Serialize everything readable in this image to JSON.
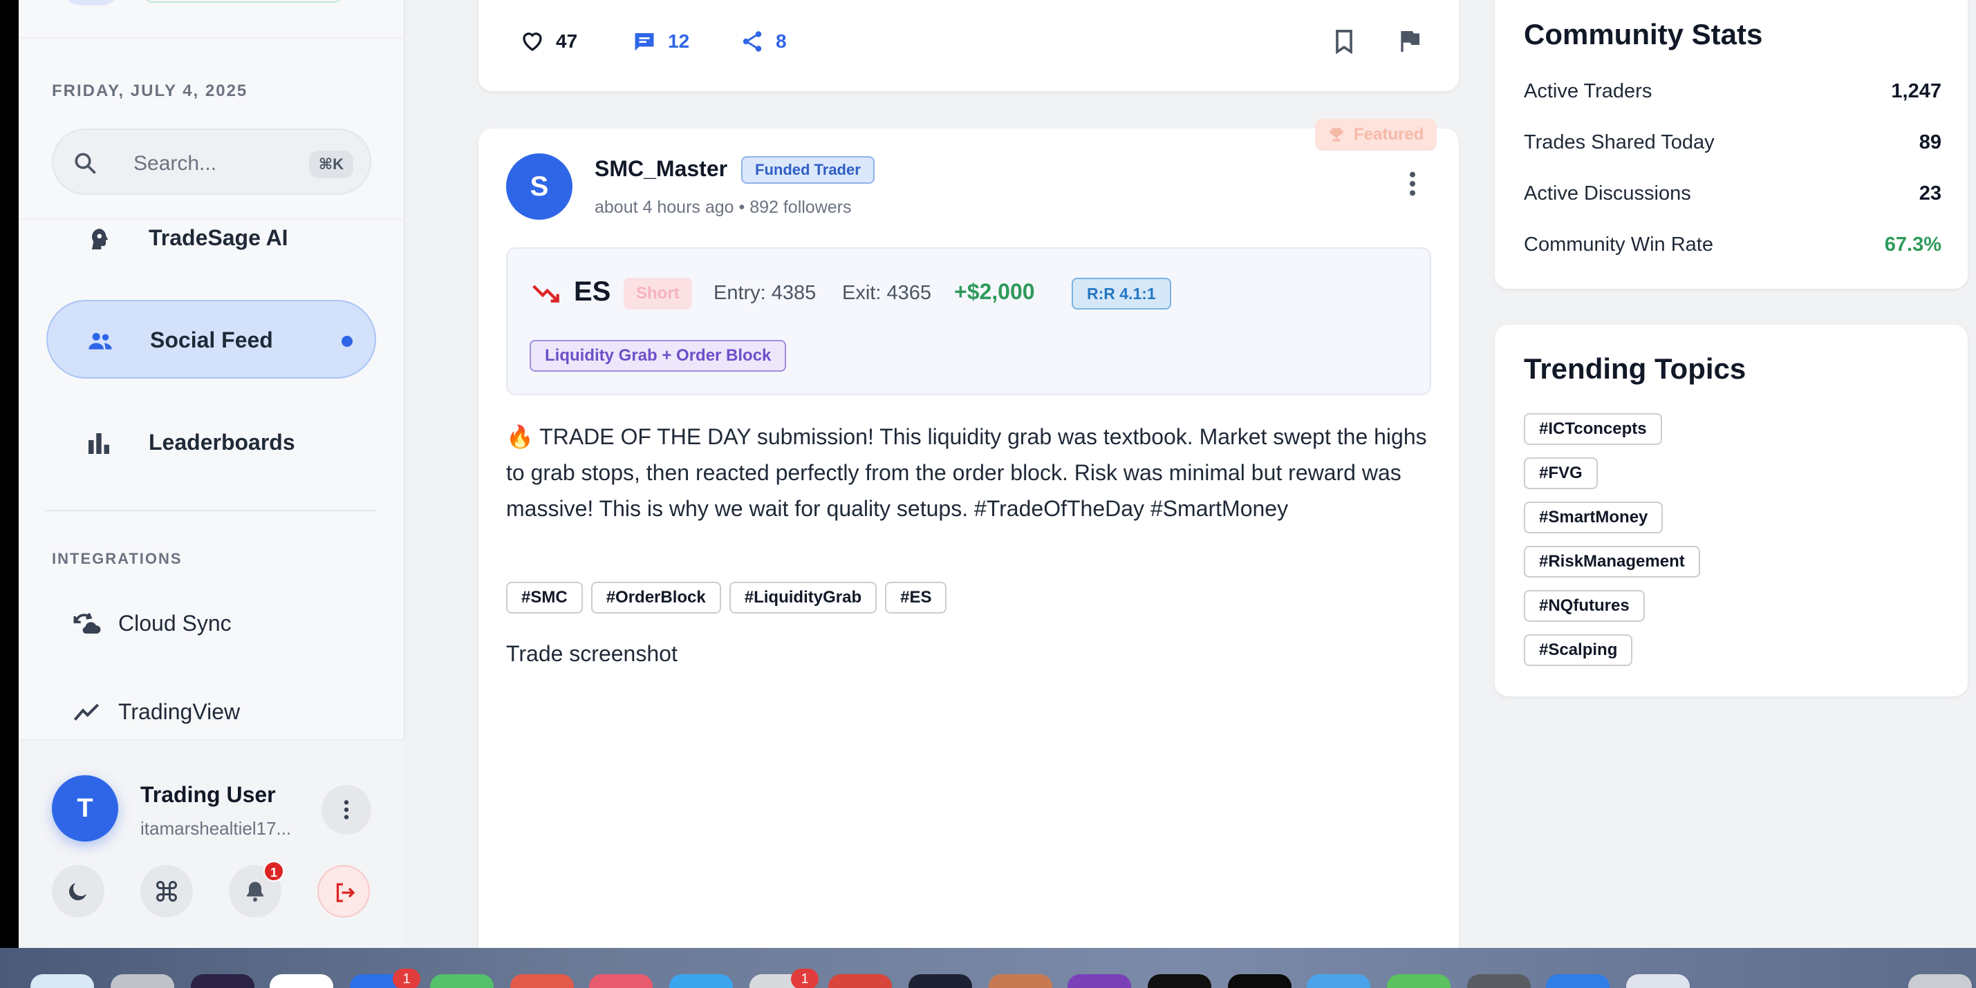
{
  "sidebar": {
    "date": "FRIDAY, JULY 4, 2025",
    "search": {
      "placeholder": "Search...",
      "shortcut": "⌘K"
    },
    "nav": [
      {
        "label": "TradeSage AI",
        "icon": "brain-icon",
        "active": false
      },
      {
        "label": "Social Feed",
        "icon": "people-icon",
        "active": true
      },
      {
        "label": "Leaderboards",
        "icon": "bar-chart-icon",
        "active": false
      }
    ],
    "integrations_title": "INTEGRATIONS",
    "integrations": [
      {
        "label": "Cloud Sync",
        "icon": "cloud-sync-icon"
      },
      {
        "label": "TradingView",
        "icon": "trend-line-icon"
      }
    ],
    "user": {
      "initial": "T",
      "name": "Trading User",
      "email": "itamarshealtiel17...",
      "notifications": "1"
    }
  },
  "previous_post": {
    "likes": "47",
    "comments": "12",
    "shares": "8"
  },
  "post": {
    "featured_label": "Featured",
    "avatar_initial": "S",
    "author": "SMC_Master",
    "badge": "Funded Trader",
    "meta": "about 4 hours ago • 892 followers",
    "trade": {
      "symbol": "ES",
      "direction": "Short",
      "entry": "Entry: 4385",
      "exit": "Exit: 4365",
      "pnl": "+$2,000",
      "rr": "R:R 4.1:1",
      "setup": "Liquidity Grab + Order Block"
    },
    "text": "🔥 TRADE OF THE DAY submission! This liquidity grab was textbook. Market swept the highs to grab stops, then reacted perfectly from the order block. Risk was minimal but reward was massive! This is why we wait for quality setups. #TradeOfTheDay #SmartMoney",
    "tags": [
      "#SMC",
      "#OrderBlock",
      "#LiquidityGrab",
      "#ES"
    ],
    "screenshot_label": "Trade screenshot"
  },
  "community_stats": {
    "title": "Community Stats",
    "rows": [
      {
        "label": "Active Traders",
        "value": "1,247"
      },
      {
        "label": "Trades Shared Today",
        "value": "89"
      },
      {
        "label": "Active Discussions",
        "value": "23"
      },
      {
        "label": "Community Win Rate",
        "value": "67.3%"
      }
    ]
  },
  "trending": {
    "title": "Trending Topics",
    "tags": [
      "#ICTconcepts",
      "#FVG",
      "#SmartMoney",
      "#RiskManagement",
      "#NQfutures",
      "#Scalping"
    ]
  },
  "dock": {
    "badges": [
      "1",
      "1"
    ]
  },
  "colors": {
    "accent": "#2f66e8",
    "profit": "#2f9a5b",
    "loss": "#dc2626"
  }
}
